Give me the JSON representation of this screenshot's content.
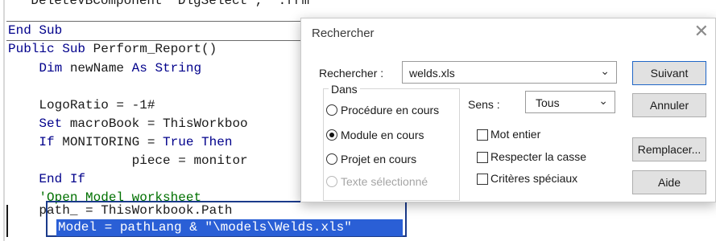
{
  "editor": {
    "lines": {
      "l0": "    DeleteVBComponent \"DlgSelect\", \".frm\"",
      "l1": "End Sub",
      "l2a": "Public Sub",
      "l2b": " Perform_Report()",
      "l3a": "    Dim",
      "l3b": " newName ",
      "l3c": "As String",
      "l5": "    LogoRatio = -1#",
      "l6a": "    Set",
      "l6b": " macroBook = ThisWorkboo",
      "l7a": "    If",
      "l7b": " MONITORING = ",
      "l7c": "True Then",
      "l8": "                piece = monitor",
      "l9": "    End If",
      "l10": "    'Open Model worksheet",
      "l11": "    path_ = ThisWorkbook.Path",
      "l12": "Model = pathLang & \"\\models\\Welds.xls\""
    }
  },
  "dialog": {
    "title": "Rechercher",
    "close_glyph": "✕",
    "search_label": "Rechercher :",
    "search_value": "welds.xls",
    "chevron": "⌄",
    "group_label": "Dans",
    "radio_procedure": "Procédure en cours",
    "radio_module": "Module en cours",
    "radio_projet": "Projet en cours",
    "radio_texte": "Texte sélectionné",
    "sens_label": "Sens :",
    "sens_value": "Tous",
    "check_mot": "Mot entier",
    "check_casse": "Respecter la casse",
    "check_criteres": "Critères spéciaux",
    "btn_suivant": "Suivant",
    "btn_annuler": "Annuler",
    "btn_remplacer": "Remplacer...",
    "btn_aide": "Aide"
  }
}
